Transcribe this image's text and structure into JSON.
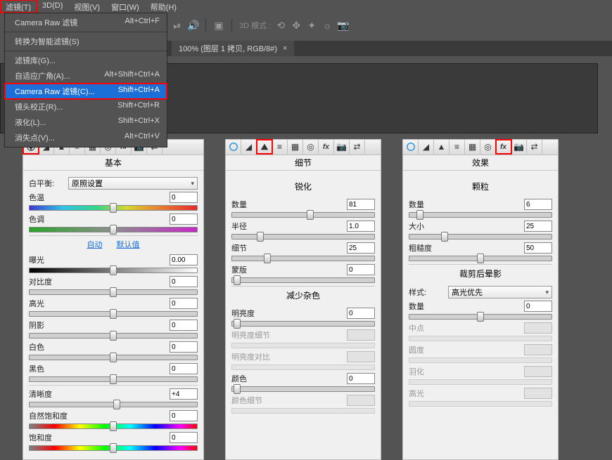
{
  "menu": {
    "items": [
      "滤镜(T)",
      "3D(D)",
      "视图(V)",
      "窗口(W)",
      "帮助(H)"
    ]
  },
  "dropdown": {
    "items": [
      {
        "label": "Camera Raw 滤镜",
        "shortcut": "Alt+Ctrl+F"
      },
      {
        "label": "转换为智能滤镜(S)",
        "shortcut": ""
      },
      {
        "label": "滤镜库(G)...",
        "shortcut": ""
      },
      {
        "label": "自适应广角(A)...",
        "shortcut": "Alt+Shift+Ctrl+A"
      },
      {
        "label": "Camera Raw 滤镜(C)...",
        "shortcut": "Shift+Ctrl+A"
      },
      {
        "label": "镜头校正(R)...",
        "shortcut": "Shift+Ctrl+R"
      },
      {
        "label": "液化(L)...",
        "shortcut": "Shift+Ctrl+X"
      },
      {
        "label": "消失点(V)...",
        "shortcut": "Alt+Ctrl+V"
      }
    ]
  },
  "toolbar": {
    "mode3d": "3D 模式 :"
  },
  "tab": {
    "title": "100% (图层 1 拷贝, RGB/8#)",
    "close": "×"
  },
  "panel1": {
    "title": "基本",
    "whiteBalanceLabel": "白平衡:",
    "whiteBalanceValue": "原照设置",
    "tempLabel": "色温",
    "tempVal": "0",
    "tintLabel": "色调",
    "tintVal": "0",
    "autoLabel": "自动",
    "defaultLabel": "默认值",
    "exposureLabel": "曝光",
    "exposureVal": "0.00",
    "contrastLabel": "对比度",
    "contrastVal": "0",
    "highlightsLabel": "高光",
    "highlightsVal": "0",
    "shadowsLabel": "阴影",
    "shadowsVal": "0",
    "whitesLabel": "白色",
    "whitesVal": "0",
    "blacksLabel": "黑色",
    "blacksVal": "0",
    "clarityLabel": "清晰度",
    "clarityVal": "+4",
    "vibranceLabel": "自然饱和度",
    "vibranceVal": "0",
    "saturationLabel": "饱和度",
    "saturationVal": "0"
  },
  "panel2": {
    "title": "细节",
    "sharpTitle": "锐化",
    "amountLabel": "数量",
    "amountVal": "81",
    "radiusLabel": "半径",
    "radiusVal": "1.0",
    "detailLabel": "细节",
    "detailVal": "25",
    "maskLabel": "蒙版",
    "maskVal": "0",
    "nrTitle": "减少杂色",
    "lumLabel": "明亮度",
    "lumVal": "0",
    "lumDetailLabel": "明亮度细节",
    "lumContrastLabel": "明亮度对比",
    "colorLabel": "颜色",
    "colorVal": "0",
    "colorDetailLabel": "颜色细节"
  },
  "panel3": {
    "title": "效果",
    "grainTitle": "颗粒",
    "gAmountLabel": "数量",
    "gAmountVal": "6",
    "gSizeLabel": "大小",
    "gSizeVal": "25",
    "gRoughLabel": "粗糙度",
    "gRoughVal": "50",
    "vigTitle": "裁剪后晕影",
    "styleLabel": "样式:",
    "styleValue": "高光优先",
    "vAmountLabel": "数量",
    "vAmountVal": "0",
    "midLabel": "中点",
    "roundLabel": "圆度",
    "featherLabel": "羽化",
    "highlightLabel": "高光"
  }
}
